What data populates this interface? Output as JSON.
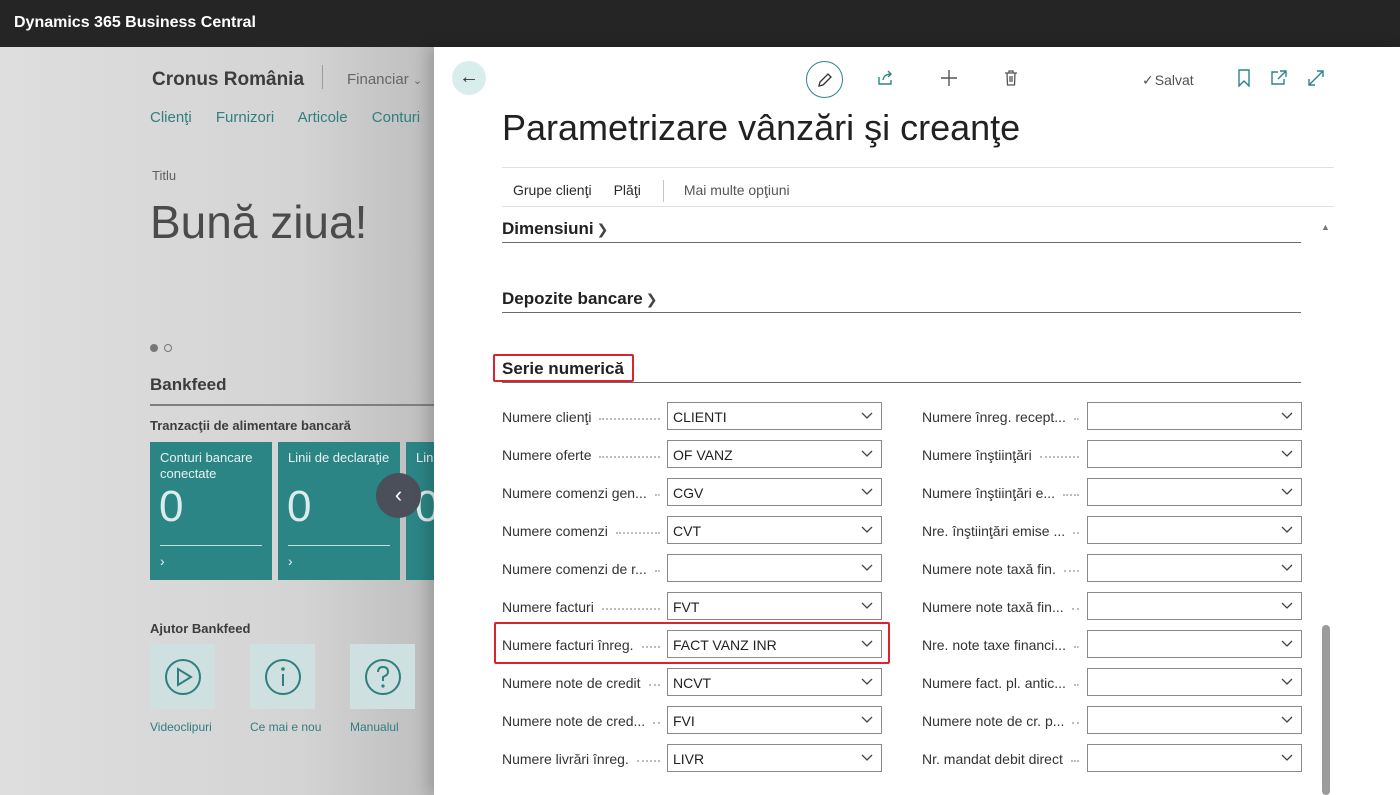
{
  "app": {
    "title": "Dynamics 365 Business Central"
  },
  "background": {
    "company": "Cronus România",
    "nav_menu": "Financiar",
    "nav_links": [
      "Clienţi",
      "Furnizori",
      "Articole",
      "Conturi"
    ],
    "header_caption": "Titlu",
    "greeting": "Bună ziua!",
    "bankfeed_title": "Bankfeed",
    "tiles_group_title": "Tranzacţii de alimentare bancară",
    "tiles": [
      {
        "label": "Conturi bancare conectate",
        "value": "0"
      },
      {
        "label": "Linii de declaraţie",
        "value": "0"
      },
      {
        "label": "Lin",
        "value": "0"
      }
    ],
    "help_title": "Ajutor Bankfeed",
    "help_items": [
      {
        "label": "Videoclipuri",
        "icon": "play-icon"
      },
      {
        "label": "Ce mai e nou",
        "icon": "info-icon"
      },
      {
        "label": "Manualul",
        "icon": "question-icon"
      }
    ]
  },
  "panel": {
    "saved_label": "Salvat",
    "page_title": "Parametrizare vânzări şi creanţe",
    "actions": [
      "Grupe clienţi",
      "Plăţi"
    ],
    "more_options": "Mai multe opţiuni",
    "sections": {
      "dimensions": "Dimensiuni",
      "bank_deposits": "Depozite bancare",
      "number_series": "Serie numerică"
    },
    "left_fields": [
      {
        "label": "Numere clienţi",
        "value": "CLIENTI"
      },
      {
        "label": "Numere oferte",
        "value": "OF VANZ"
      },
      {
        "label": "Numere comenzi gen...",
        "value": "CGV"
      },
      {
        "label": "Numere comenzi",
        "value": "CVT"
      },
      {
        "label": "Numere comenzi de r...",
        "value": ""
      },
      {
        "label": "Numere facturi",
        "value": "FVT"
      },
      {
        "label": "Numere facturi înreg.",
        "value": "FACT VANZ INR"
      },
      {
        "label": "Numere note de credit",
        "value": "NCVT"
      },
      {
        "label": "Numere note de cred...",
        "value": "FVI"
      },
      {
        "label": "Numere livrări înreg.",
        "value": "LIVR"
      }
    ],
    "right_fields": [
      {
        "label": "Numere înreg. recept...",
        "value": ""
      },
      {
        "label": "Numere înştiinţări",
        "value": ""
      },
      {
        "label": "Numere înştiinţări e...",
        "value": ""
      },
      {
        "label": "Nre. înştiinţări emise ...",
        "value": ""
      },
      {
        "label": "Numere note taxă fin.",
        "value": ""
      },
      {
        "label": "Numere note taxă fin...",
        "value": ""
      },
      {
        "label": "Nre. note taxe financi...",
        "value": ""
      },
      {
        "label": "Numere fact. pl. antic...",
        "value": ""
      },
      {
        "label": "Numere note de cr. p...",
        "value": ""
      },
      {
        "label": "Nr. mandat debit direct",
        "value": ""
      }
    ]
  }
}
